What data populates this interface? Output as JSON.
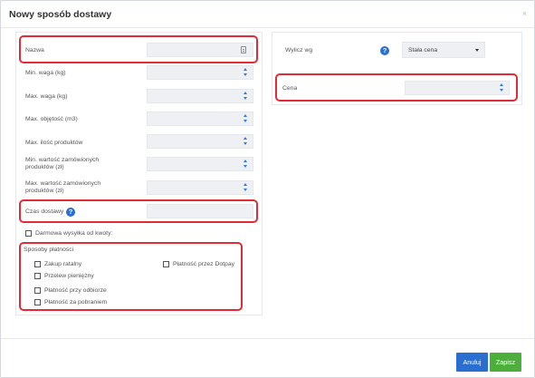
{
  "dialog": {
    "title": "Nowy sposób dostawy",
    "close_label": "×"
  },
  "form": {
    "name_label": "Nazwa",
    "min_weight_label": "Min. waga (kg)",
    "max_weight_label": "Max. waga (kg)",
    "max_volume_label": "Max. objętość (m3)",
    "max_products_label": "Max. ilość produktów",
    "min_order_value_label_1": "Min. wartość zamówionych",
    "min_order_value_label_2": "produktów (zł)",
    "max_order_value_label_1": "Max. wartość zamówionych",
    "max_order_value_label_2": "produktów (zł)",
    "delivery_time_label": "Czas dostawy",
    "free_shipping_label": "Darmowa wysyłka od kwoty:",
    "payment_methods_label": "Sposoby płatności",
    "payments": {
      "installments": "Zakup ratalny",
      "transfer": "Przelew pieniężny",
      "on_pickup": "Płatność przy odbiorze",
      "cod": "Płatność za pobraniem",
      "dotpay": "Płatność przez Dotpay"
    }
  },
  "pricing": {
    "calc_label": "Wylicz wg",
    "calc_selected": "Stała cena",
    "price_label": "Cena"
  },
  "footer": {
    "cancel_label": "Anuluj",
    "save_label": "Zapisz"
  },
  "icons": {
    "help": "help-icon",
    "doc": "document-icon",
    "spinner": "spinner-arrows-icon",
    "dropdown": "chevron-down-icon"
  },
  "colors": {
    "primary": "#2a6fcf",
    "save": "#4caf3b",
    "highlight": "#e02b38"
  }
}
